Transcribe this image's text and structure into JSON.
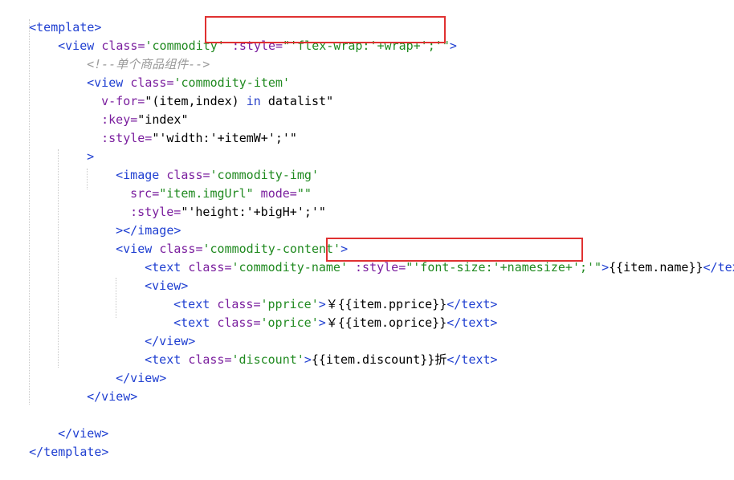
{
  "colors": {
    "tag": "#1f3fd1",
    "attribute": "#7a1e9e",
    "string": "#208a20",
    "comment": "#9a9a9a",
    "highlight_box": "#e03131"
  },
  "lines": {
    "l1": [
      "<template>"
    ],
    "l2": [
      "<view ",
      "class=",
      "'commodity'",
      " ",
      ":style=",
      "\"'flex-wrap:'+wrap+';'\"",
      ">"
    ],
    "l3": [
      "<!--单个商品组件-->"
    ],
    "l4": [
      "<view ",
      "class=",
      "'commodity-item'"
    ],
    "l5": [
      "v-for=",
      "\"(item,index) ",
      "in",
      " datalist\""
    ],
    "l6": [
      ":key=",
      "\"index\""
    ],
    "l7": [
      ":style=",
      "\"'width:'+itemW+';'\""
    ],
    "l8": [
      ">"
    ],
    "l9": [
      "<image ",
      "class=",
      "'commodity-img'"
    ],
    "l10": [
      "src=",
      "\"item.imgUrl\"",
      " mode=",
      "\"\""
    ],
    "l11": [
      ":style=",
      "\"'height:'+bigH+';'\""
    ],
    "l12": [
      "></image>"
    ],
    "l13": [
      "<view ",
      "class=",
      "'commodity-content'",
      ">"
    ],
    "l14": [
      "<text ",
      "class=",
      "'commodity-name'",
      " ",
      ":style=",
      "\"'font-size:'+namesize+';'\"",
      ">",
      "{{item.name}}",
      "</text>"
    ],
    "l15": [
      "<view>"
    ],
    "l16": [
      "<text ",
      "class=",
      "'pprice'",
      ">",
      "￥{{item.pprice}}",
      "</text>"
    ],
    "l17": [
      "<text ",
      "class=",
      "'oprice'",
      ">",
      "￥{{item.oprice}}",
      "</text>"
    ],
    "l18": [
      "</view>"
    ],
    "l19": [
      "<text ",
      "class=",
      "'discount'",
      ">",
      "{{item.discount}}折",
      "</text>"
    ],
    "l20": [
      "</view>"
    ],
    "l21": [
      "</view>"
    ],
    "l22": [
      "</view>"
    ],
    "l23": [
      "</template>"
    ]
  }
}
